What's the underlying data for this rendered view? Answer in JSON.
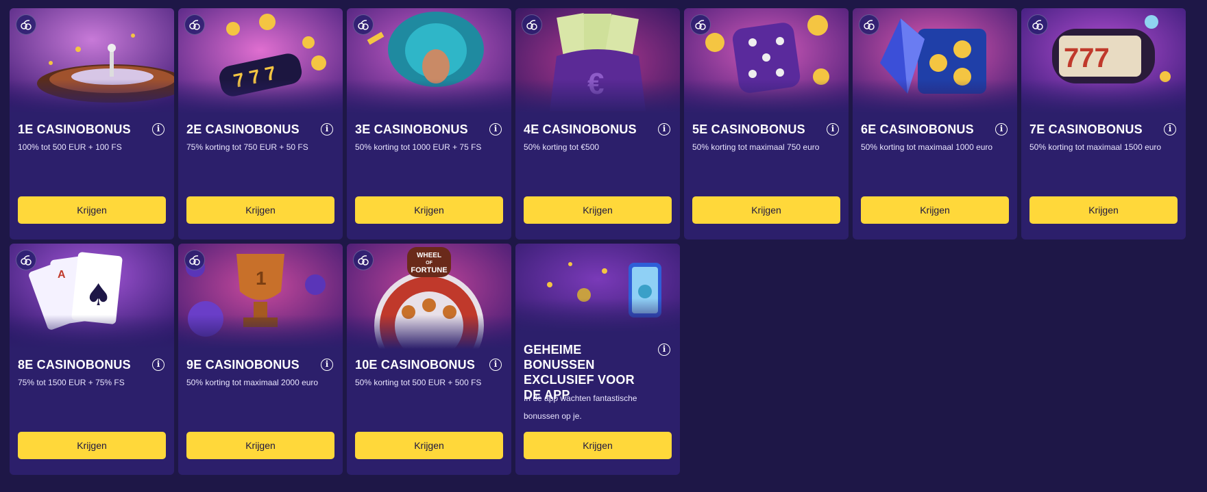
{
  "bonuses": [
    {
      "title": "1E CASINOBONUS",
      "desc": "100% tot 500 EUR + 100 FS",
      "button": "Krijgen",
      "art": "roulette"
    },
    {
      "title": "2E CASINOBONUS",
      "desc": "75% korting tot 750 EUR + 50 FS",
      "button": "Krijgen",
      "art": "slot-777"
    },
    {
      "title": "3E CASINOBONUS",
      "desc": "50% korting tot 1000 EUR + 75 FS",
      "button": "Krijgen",
      "art": "carnival-dancer"
    },
    {
      "title": "4E CASINOBONUS",
      "desc": "50% korting tot €500",
      "button": "Krijgen",
      "art": "money-bag"
    },
    {
      "title": "5E CASINOBONUS",
      "desc": "50% korting tot maximaal 750 euro",
      "button": "Krijgen",
      "art": "dice"
    },
    {
      "title": "6E CASINOBONUS",
      "desc": "50% korting tot maximaal 1000 euro",
      "button": "Krijgen",
      "art": "gem-reels"
    },
    {
      "title": "7E CASINOBONUS",
      "desc": "50% korting tot maximaal 1500 euro",
      "button": "Krijgen",
      "art": "slot-barrel"
    },
    {
      "title": "8E CASINOBONUS",
      "desc": "75% tot 1500 EUR + 75% FS",
      "button": "Krijgen",
      "art": "playing-cards"
    },
    {
      "title": "9E CASINOBONUS",
      "desc": "50% korting tot maximaal 2000 euro",
      "button": "Krijgen",
      "art": "trophy"
    },
    {
      "title": "10E CASINOBONUS",
      "desc": "50% korting tot 500 EUR + 500 FS",
      "button": "Krijgen",
      "art": "wheel-of-fortune",
      "art_text": [
        "WHEEL",
        "OF",
        "FORTUNE"
      ]
    },
    {
      "title": "GEHEIME BONUSSEN EXCLUSIEF VOOR DE APP",
      "desc": "In de app wachten fantastische bonussen op je.",
      "button": "Krijgen",
      "art": "phone-app"
    }
  ],
  "info_glyph": "i",
  "colors": {
    "background": "#1e1747",
    "card": "#2c1f6b",
    "button": "#ffd83a",
    "button_text": "#1c1640"
  }
}
